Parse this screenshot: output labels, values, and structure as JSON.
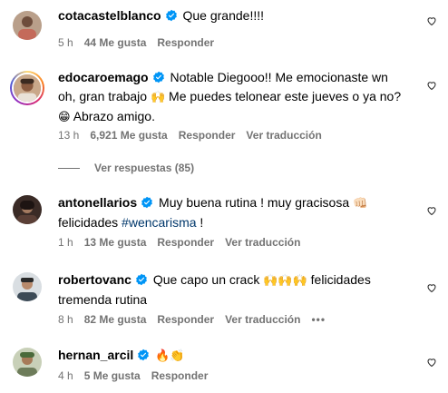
{
  "comments": [
    {
      "username": "cotacastelblanco",
      "text": "Que grande!!!!",
      "time": "5 h",
      "likes": "44 Me gusta",
      "reply": "Responder",
      "translate": ""
    },
    {
      "username": "edocaroemago",
      "text_a": "Notable Diegooo!! Me emocionaste wn oh, gran trabajo",
      "emoji_a": "🙌",
      "text_b": "Me puedes telonear este jueves o ya no?",
      "emoji_b": "😁",
      "text_c": "Abrazo amigo.",
      "time": "13 h",
      "likes": "6,921 Me gusta",
      "reply": "Responder",
      "translate": "Ver traducción"
    },
    {
      "username": "antonellarios",
      "text_a": "Muy buena rutina ! muy gracisosa",
      "emoji_a": "👊🏻",
      "text_b": "felicidades",
      "hashtag": "#wencarisma",
      "text_c": "!",
      "time": "1 h",
      "likes": "13 Me gusta",
      "reply": "Responder",
      "translate": "Ver traducción"
    },
    {
      "username": "robertovanc",
      "text_a": "Que capo un crack",
      "emoji_a": "🙌🙌🙌",
      "text_b": "felicidades tremenda rutina",
      "time": "8 h",
      "likes": "82 Me gusta",
      "reply": "Responder",
      "translate": "Ver traducción",
      "more": "•••"
    },
    {
      "username": "hernan_arcil",
      "emoji_a": "🔥👏",
      "time": "4 h",
      "likes": "5 Me gusta",
      "reply": "Responder"
    }
  ],
  "view_replies": "Ver respuestas (85)",
  "colors": {
    "verified": "#0095f6",
    "meta": "#737373",
    "hashtag": "#00376b"
  }
}
